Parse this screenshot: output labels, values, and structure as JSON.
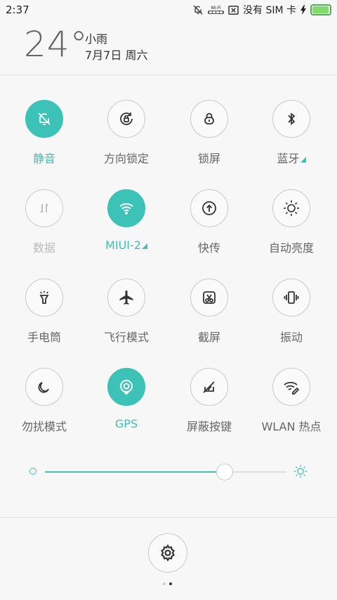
{
  "status_bar": {
    "time": "2:37",
    "wifi_label": "Wi-Fi",
    "carrier": "没有 SIM 卡",
    "battery_level": 0.95,
    "icons": [
      "mute-bell-icon",
      "wifi-badge-icon",
      "no-signal-icon",
      "charging-bolt-icon",
      "battery-icon"
    ]
  },
  "weather": {
    "temperature": "24°",
    "condition": "小雨",
    "date": "7月7日 周六"
  },
  "toggles": [
    {
      "label": "静音",
      "icon": "bell-off-icon",
      "state": "on"
    },
    {
      "label": "方向锁定",
      "icon": "rotation-lock-icon",
      "state": "off"
    },
    {
      "label": "锁屏",
      "icon": "lock-icon",
      "state": "off"
    },
    {
      "label": "蓝牙",
      "icon": "bluetooth-icon",
      "state": "off",
      "has_corner": true
    },
    {
      "label": "数据",
      "icon": "mobile-data-icon",
      "state": "disabled"
    },
    {
      "label": "MIUI-2",
      "icon": "wifi-icon",
      "state": "on",
      "has_corner": true
    },
    {
      "label": "快传",
      "icon": "quick-transfer-icon",
      "state": "off"
    },
    {
      "label": "自动亮度",
      "icon": "auto-brightness-icon",
      "state": "off"
    },
    {
      "label": "手电筒",
      "icon": "flashlight-icon",
      "state": "off"
    },
    {
      "label": "飞行模式",
      "icon": "airplane-icon",
      "state": "off"
    },
    {
      "label": "截屏",
      "icon": "screenshot-icon",
      "state": "off"
    },
    {
      "label": "振动",
      "icon": "vibrate-icon",
      "state": "off"
    },
    {
      "label": "勿扰模式",
      "icon": "moon-icon",
      "state": "off"
    },
    {
      "label": "GPS",
      "icon": "gps-icon",
      "state": "on"
    },
    {
      "label": "屏蔽按键",
      "icon": "block-keys-icon",
      "state": "off"
    },
    {
      "label": "WLAN 热点",
      "icon": "hotspot-icon",
      "state": "off"
    }
  ],
  "brightness": {
    "level": 0.74
  },
  "pager": {
    "pages": 2,
    "current": 2
  },
  "colors": {
    "accent": "#3cc2b6",
    "icon_dark": "#333333",
    "label": "#666666",
    "disabled": "#bbbbbb"
  }
}
